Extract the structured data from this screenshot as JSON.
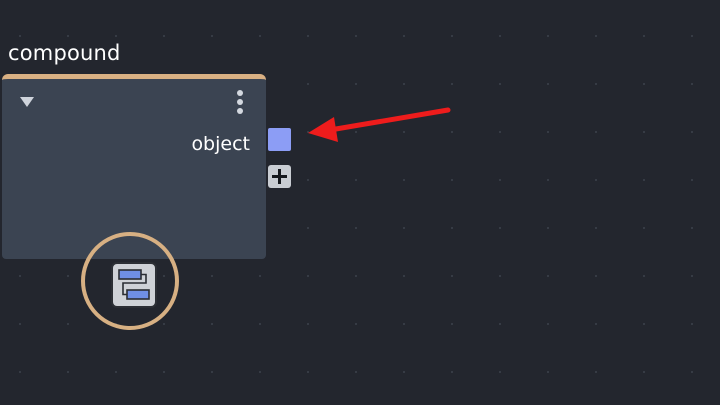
{
  "node": {
    "title": "compound",
    "output_port": {
      "label": "object",
      "color": "#8c9df5"
    },
    "header_accent_color": "#d9b083",
    "icons": {
      "collapse": "triangle-down-icon",
      "menu": "kebab-menu-icon",
      "add_port": "plus-icon",
      "badge": "compound-node-icon"
    }
  },
  "annotation": {
    "arrow_color": "#ee1c1c"
  }
}
